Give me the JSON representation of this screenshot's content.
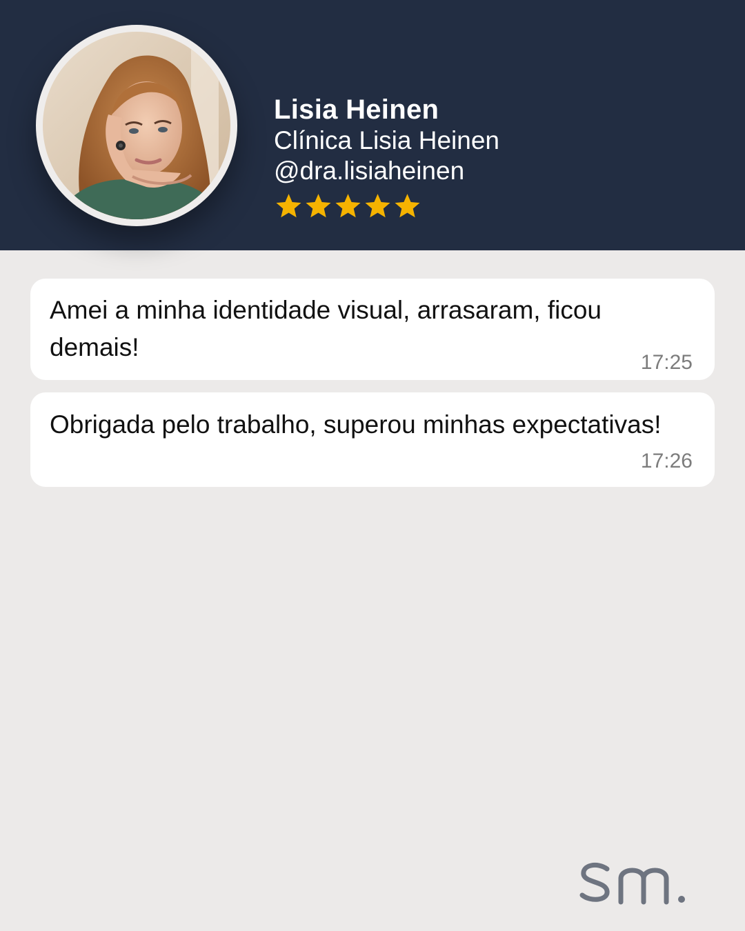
{
  "profile": {
    "name": "Lisia Heinen",
    "clinic": "Clínica Lisia Heinen",
    "handle": "@dra.lisiaheinen",
    "rating": 5,
    "rating_max": 5,
    "star_color": "#F5B301"
  },
  "messages": [
    {
      "text": "Amei a minha identidade visual, arrasaram, ficou demais!",
      "time": "17:25"
    },
    {
      "text": "Obrigada pelo trabalho, superou minhas expectativas!",
      "time": "17:26"
    }
  ],
  "brand": {
    "logo": "sm.",
    "logo_color": "#6E7480"
  },
  "colors": {
    "header_bg": "#222D42",
    "page_bg": "#ECEAE9",
    "bubble_bg": "#FFFFFF"
  }
}
